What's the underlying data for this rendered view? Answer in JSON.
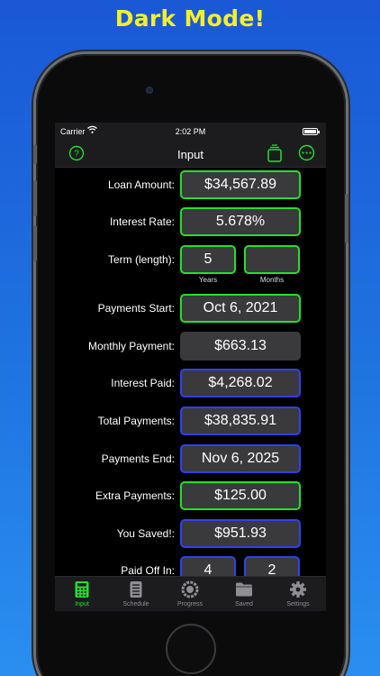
{
  "banner": "Dark Mode!",
  "status": {
    "carrier": "Carrier",
    "time": "2:02 PM"
  },
  "nav": {
    "title": "Input"
  },
  "rows": {
    "loan_amount": {
      "label": "Loan Amount:",
      "value": "$34,567.89"
    },
    "interest_rate": {
      "label": "Interest Rate:",
      "value": "5.678%"
    },
    "term": {
      "label": "Term (length):",
      "years": "5",
      "months": "",
      "years_label": "Years",
      "months_label": "Months"
    },
    "payments_start": {
      "label": "Payments Start:",
      "value": "Oct 6, 2021"
    },
    "monthly_payment": {
      "label": "Monthly Payment:",
      "value": "$663.13"
    },
    "interest_paid": {
      "label": "Interest Paid:",
      "value": "$4,268.02"
    },
    "total_payments": {
      "label": "Total Payments:",
      "value": "$38,835.91"
    },
    "payments_end": {
      "label": "Payments End:",
      "value": "Nov 6, 2025"
    },
    "extra_payments": {
      "label": "Extra Payments:",
      "value": "$125.00"
    },
    "you_saved": {
      "label": "You Saved!:",
      "value": "$951.93"
    },
    "paid_off_in": {
      "label": "Paid Off In:",
      "years": "4",
      "months": "2"
    }
  },
  "tabs": [
    {
      "label": "Input",
      "icon": "calculator-icon"
    },
    {
      "label": "Schedule",
      "icon": "list-icon"
    },
    {
      "label": "Progress",
      "icon": "progress-ring-icon"
    },
    {
      "label": "Saved",
      "icon": "folder-icon"
    },
    {
      "label": "Settings",
      "icon": "gear-icon"
    }
  ],
  "colors": {
    "input_border": "#22e12a",
    "output_border": "#2f40f0",
    "background": "#1f74e0",
    "banner": "#f5ee2c"
  }
}
